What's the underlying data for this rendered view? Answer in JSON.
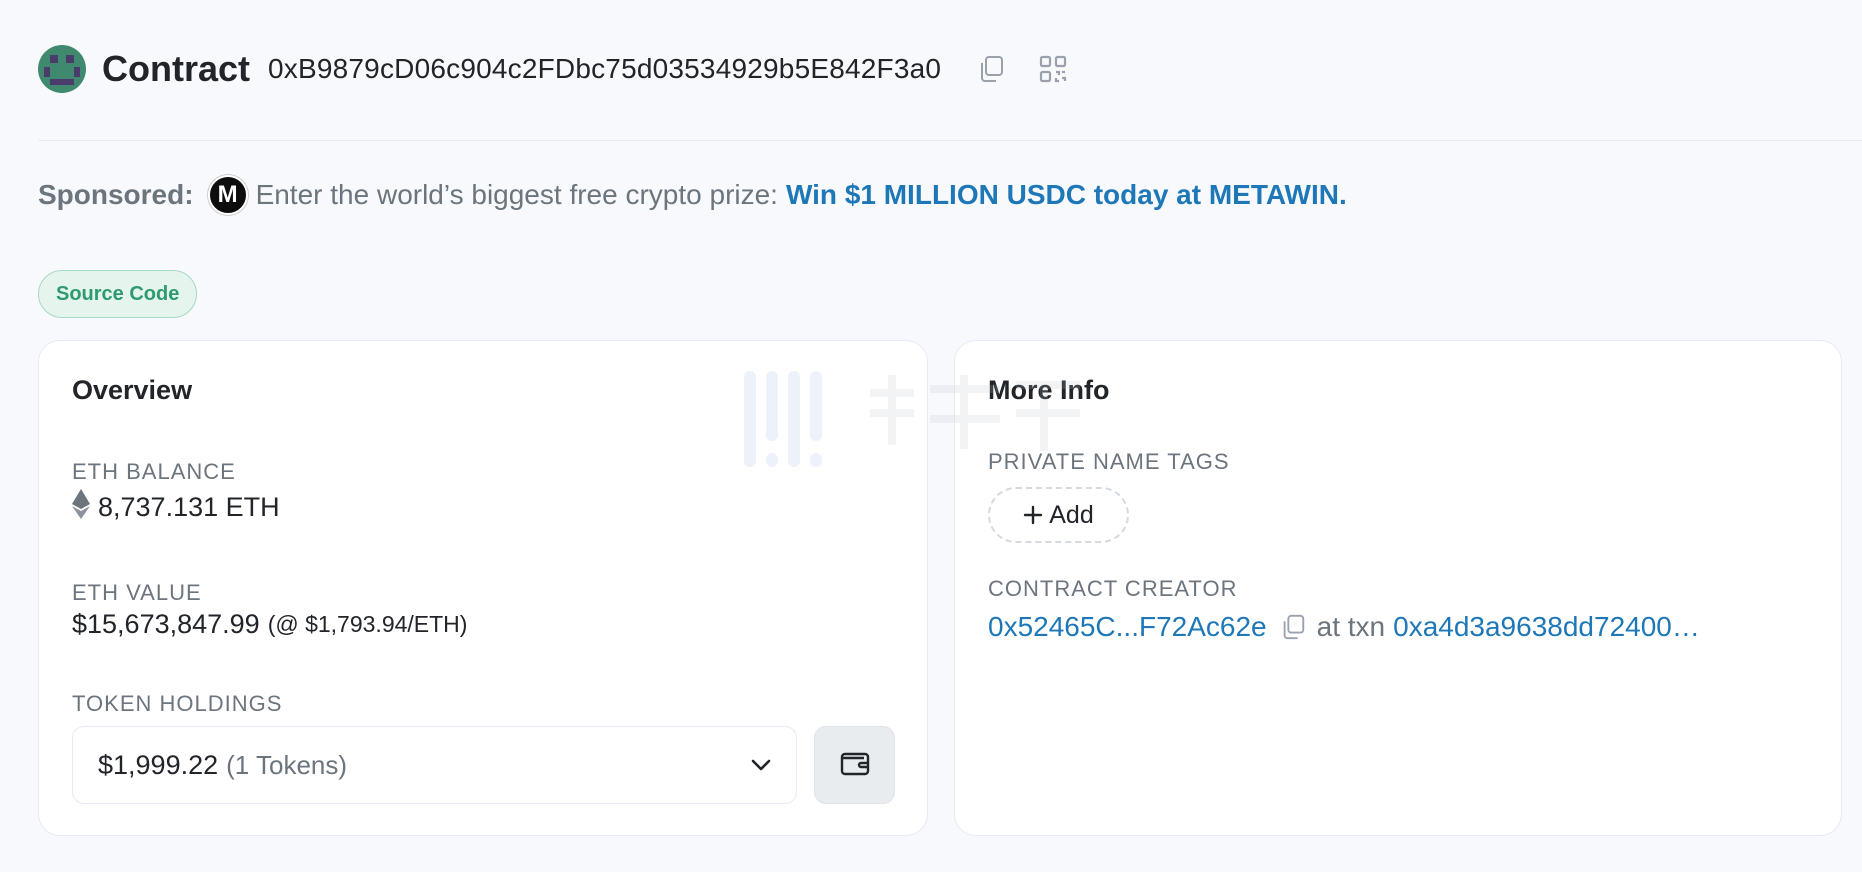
{
  "header": {
    "title": "Contract",
    "address": "0xB9879cD06c904c2FDbc75d03534929b5E842F3a0",
    "copy_icon": "copy-icon",
    "qr_icon": "qr-code-icon"
  },
  "sponsored": {
    "label": "Sponsored:",
    "logo_letter": "M",
    "text": "Enter the world’s biggest free crypto prize:",
    "link_text": "Win $1 MILLION USDC today at METAWIN."
  },
  "badge": {
    "label": "Source Code"
  },
  "overview": {
    "title": "Overview",
    "eth_balance_label": "ETH BALANCE",
    "eth_balance_value": "8,737.131 ETH",
    "eth_value_label": "ETH VALUE",
    "eth_value_amount": "$15,673,847.99",
    "eth_value_price": "(@ $1,793.94/ETH)",
    "token_holdings_label": "TOKEN HOLDINGS",
    "token_holdings_amount": "$1,999.22",
    "token_holdings_count": "(1 Tokens)"
  },
  "more_info": {
    "title": "More Info",
    "private_tags_label": "PRIVATE NAME TAGS",
    "add_label": "Add",
    "creator_label": "CONTRACT CREATOR",
    "creator_address": "0x52465C...F72Ac62e",
    "at_txn_text": "at txn",
    "creator_txn": "0xa4d3a9638dd72400…"
  },
  "colors": {
    "accent_link": "#1e78b8",
    "badge_green": "#2d9b6f",
    "muted_text": "#6c757d",
    "page_bg": "#f8f9fc"
  }
}
